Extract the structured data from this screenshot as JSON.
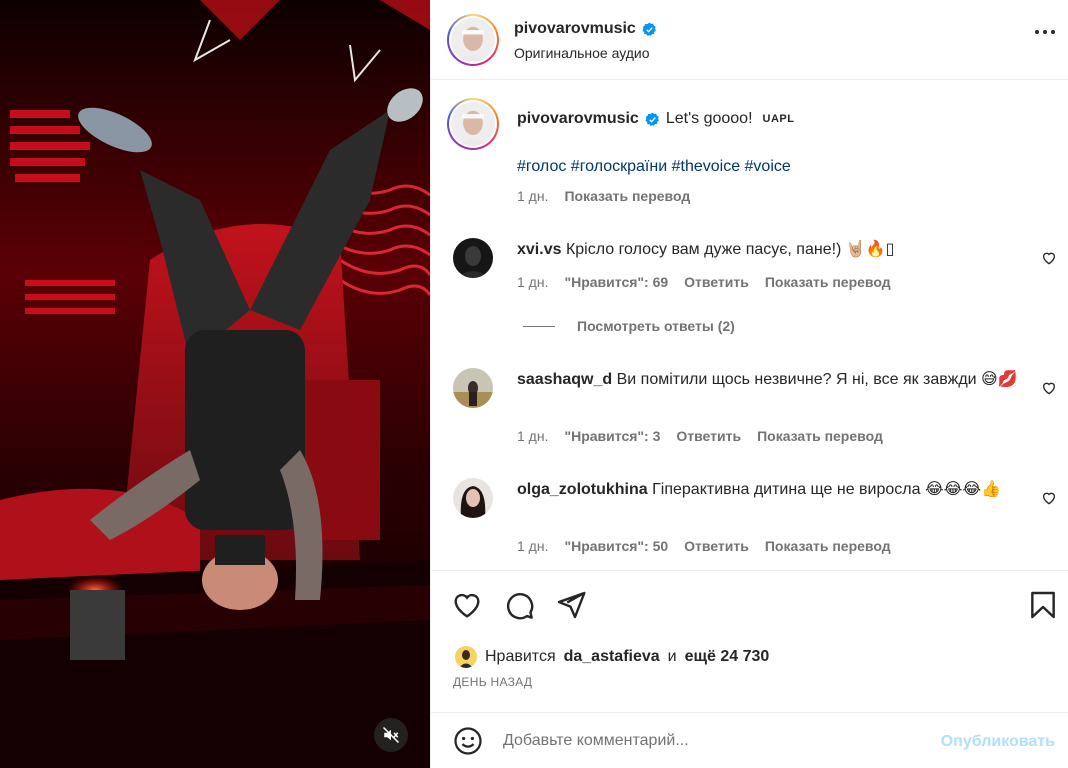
{
  "post": {
    "username": "pivovarovmusic",
    "audio_label": "Оригинальное аудио",
    "verified_icon": "verified-badge-icon",
    "menu_icon": "more-options-icon"
  },
  "caption": {
    "username": "pivovarovmusic",
    "text": "Let's goooo!",
    "tag_label": "UAPL",
    "hashtags": "#голос #голоскраїни #thevoice #voice",
    "time": "1 дн.",
    "translate": "Показать перевод"
  },
  "comments": [
    {
      "username": "xvi.vs",
      "text": "Крісло голосу вам дуже пасує, пане!) 🤘🏼🔥▯",
      "time": "1 дн.",
      "likes": "\"Нравится\": 69",
      "reply": "Ответить",
      "translate": "Показать перевод",
      "view_replies": "Посмотреть ответы (2)"
    },
    {
      "username": "saashaqw_d",
      "text": "Ви помітили щось незвичне? Я ні, все як завжди 😅💋",
      "time": "1 дн.",
      "likes": "\"Нравится\": 3",
      "reply": "Ответить",
      "translate": "Показать перевод"
    },
    {
      "username": "olga_zolotukhina",
      "text": "Гіперактивна дитина ще не виросла 😂😂😂👍",
      "time": "1 дн.",
      "likes": "\"Нравится\": 50",
      "reply": "Ответить",
      "translate": "Показать перевод"
    }
  ],
  "likes": {
    "prefix": "Нравится",
    "user": "da_astafieva",
    "and": "и",
    "count_text": "ещё 24 730"
  },
  "date": "ДЕНЬ НАЗАД",
  "add_comment": {
    "placeholder": "Добавьте комментарий...",
    "post_label": "Опубликовать"
  },
  "icons": {
    "like": "heart-icon",
    "comment": "comment-icon",
    "share": "send-icon",
    "save": "bookmark-icon",
    "emoji": "emoji-icon",
    "mute": "muted-speaker-icon"
  },
  "colors": {
    "link": "#00376b",
    "muted": "#737373",
    "post_disabled": "#b2dffc",
    "verified": "#0095f6"
  }
}
